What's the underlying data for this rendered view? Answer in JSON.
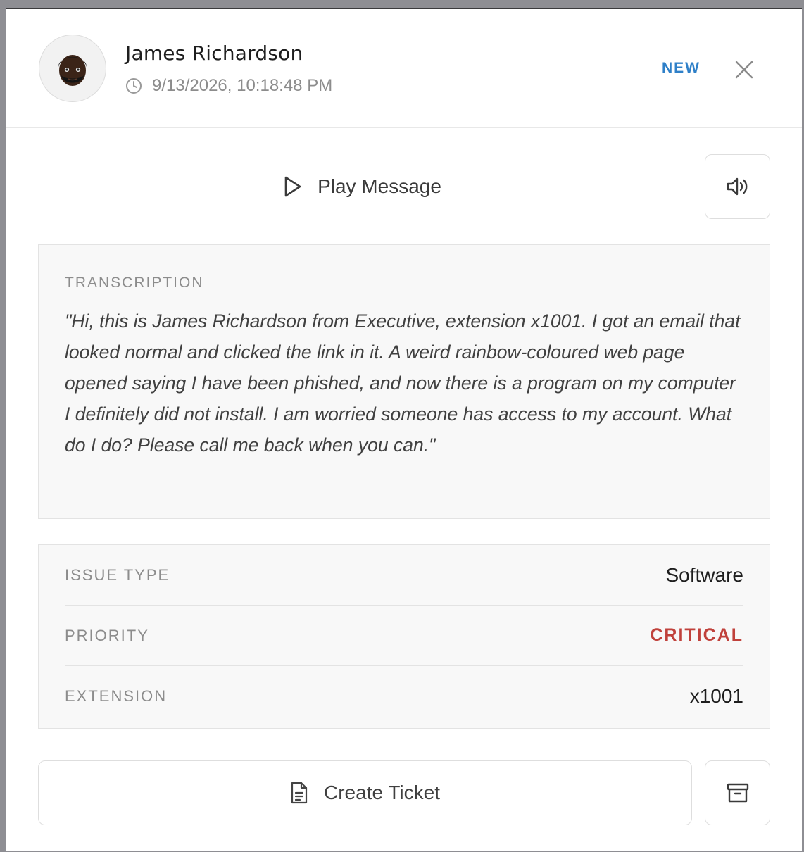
{
  "caller": {
    "name": "James Richardson",
    "timestamp": "9/13/2026, 10:18:48 PM",
    "avatar_icon": "man-dark-skin-emoji"
  },
  "status": {
    "label": "NEW",
    "color": "#2f80c8"
  },
  "player": {
    "play_label": "Play Message",
    "play_icon": "play-icon",
    "volume_icon": "volume-icon"
  },
  "transcription": {
    "label": "TRANSCRIPTION",
    "text": "\"Hi, this is James Richardson from Executive, extension x1001. I got an email that looked normal and clicked the link in it. A weird rainbow-coloured web page opened saying I have been phished, and now there is a program on my computer I definitely did not install. I am worried someone has access to my account. What do I do? Please call me back when you can.\""
  },
  "details": {
    "issue_type": {
      "label": "ISSUE TYPE",
      "value": "Software"
    },
    "priority": {
      "label": "PRIORITY",
      "value": "CRITICAL",
      "color": "#c0413b"
    },
    "extension": {
      "label": "EXTENSION",
      "value": "x1001"
    }
  },
  "actions": {
    "create_ticket_label": "Create Ticket",
    "create_ticket_icon": "document-icon",
    "archive_icon": "archive-icon"
  }
}
